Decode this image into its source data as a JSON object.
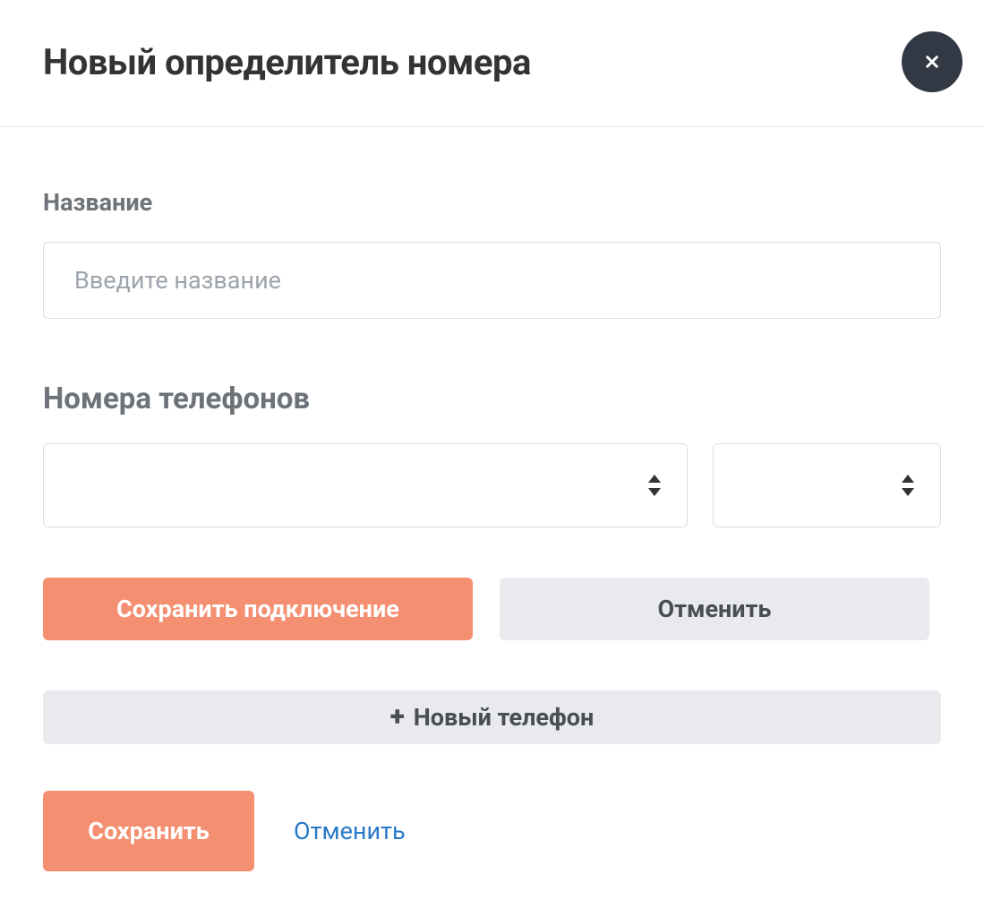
{
  "header": {
    "title": "Новый определитель номера"
  },
  "form": {
    "name_label": "Название",
    "name_placeholder": "Введите название",
    "name_value": "",
    "phones_label": "Номера телефонов",
    "phone_select_value": "",
    "type_select_value": "",
    "save_connection_label": "Сохранить подключение",
    "cancel_connection_label": "Отменить",
    "new_phone_label": "Новый телефон"
  },
  "footer": {
    "save_label": "Сохранить",
    "cancel_label": "Отменить"
  }
}
